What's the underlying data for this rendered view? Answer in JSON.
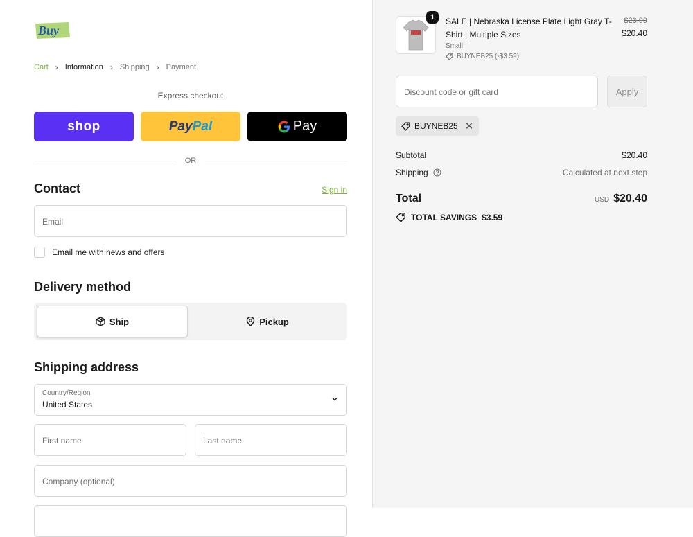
{
  "logo": {
    "text": "Buy"
  },
  "breadcrumb": [
    {
      "label": "Cart"
    },
    {
      "label": "Information"
    },
    {
      "label": "Shipping"
    },
    {
      "label": "Payment"
    }
  ],
  "express": {
    "label": "Express checkout",
    "shop_label": "shop",
    "paypal_part1": "Pay",
    "paypal_part2": "Pal",
    "gpay_label": "Pay",
    "or_label": "OR"
  },
  "contact": {
    "title": "Contact",
    "signin_label": "Sign in",
    "email_placeholder": "Email",
    "news_label": "Email me with news and offers"
  },
  "delivery": {
    "title": "Delivery method",
    "ship_label": "Ship",
    "pickup_label": "Pickup"
  },
  "shipping_address": {
    "title": "Shipping address",
    "country_label": "Country/Region",
    "country_value": "United States",
    "first_name_placeholder": "First name",
    "last_name_placeholder": "Last name",
    "company_placeholder": "Company (optional)"
  },
  "order": {
    "item": {
      "name": "SALE | Nebraska License Plate Light Gray T-Shirt | Multiple Sizes",
      "variant": "Small",
      "discount": "BUYNEB25 (-$3.59)",
      "quantity": "1",
      "original_price": "$23.99",
      "price": "$20.40"
    },
    "discount_placeholder": "Discount code or gift card",
    "apply_label": "Apply",
    "applied_code": "BUYNEB25",
    "subtotal_label": "Subtotal",
    "subtotal_value": "$20.40",
    "shipping_label": "Shipping",
    "shipping_value": "Calculated at next step",
    "total_label": "Total",
    "currency": "USD",
    "total_value": "$20.40",
    "savings_label": "TOTAL SAVINGS",
    "savings_value": "$3.59"
  },
  "colors": {
    "accent": "#7db43c",
    "shop_purple": "#5a31f4",
    "paypal_yellow": "#ffc439",
    "gpay_black": "#000000"
  }
}
